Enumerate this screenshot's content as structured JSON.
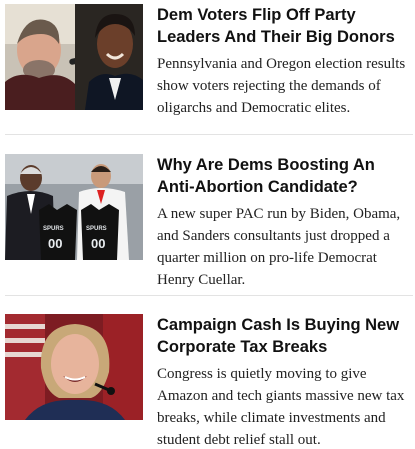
{
  "articles": [
    {
      "headline": "Dem Voters Flip Off Party Leaders And Their Big Donors",
      "dek": "Pennsylvania and Oregon election results show voters rejecting the demands of oligarchs and Democratic elites.",
      "image": "two-politicians-speaking-photo"
    },
    {
      "headline": "Why Are Dems Boosting An Anti-Abortion Candidate?",
      "dek": "A new super PAC run by Biden, Obama, and Sanders consultants just dropped a quarter million on pro-life Democrat Henry Cuellar.",
      "image": "politicians-holding-spurs-jerseys-photo",
      "jersey_text": [
        "SPURS",
        "00",
        "SPURS",
        "00"
      ]
    },
    {
      "headline": "Campaign Cash Is Buying New Corporate Tax Breaks",
      "dek": "Congress is quietly moving to give Amazon and tech giants massive new tax breaks, while climate investments and student debt relief stall out.",
      "image": "woman-at-microphone-photo"
    }
  ],
  "colors": {
    "headline": "#111111",
    "dek": "#222222",
    "divider": "#e3e3e3"
  }
}
